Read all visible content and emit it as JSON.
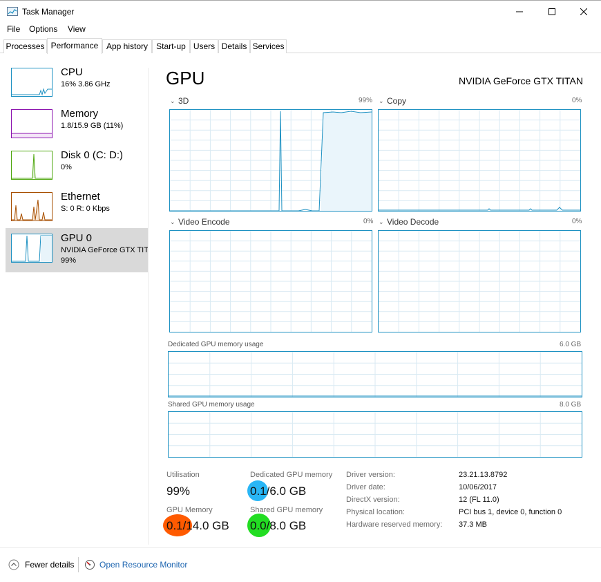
{
  "window": {
    "title": "Task Manager"
  },
  "menu": [
    "File",
    "Options",
    "View"
  ],
  "tabs": [
    "Processes",
    "Performance",
    "App history",
    "Start-up",
    "Users",
    "Details",
    "Services"
  ],
  "sidebar": [
    {
      "title": "CPU",
      "sub": "16% 3.86 GHz",
      "color": "#1d91c2"
    },
    {
      "title": "Memory",
      "sub": "1.8/15.9 GB (11%)",
      "color": "#8b12ae"
    },
    {
      "title": "Disk 0 (C: D:)",
      "sub": "0%",
      "color": "#4da60c"
    },
    {
      "title": "Ethernet",
      "sub": "S: 0 R: 0 Kbps",
      "color": "#a74f01"
    },
    {
      "title": "GPU 0",
      "sub": "NVIDIA GeForce GTX TITAN",
      "sub2": "99%",
      "color": "#1d91c2"
    }
  ],
  "gpu": {
    "heading": "GPU",
    "model": "NVIDIA GeForce GTX TITAN",
    "engines": [
      {
        "name": "3D",
        "max": "99%"
      },
      {
        "name": "Copy",
        "max": "0%"
      },
      {
        "name": "Video Encode",
        "max": "0%"
      },
      {
        "name": "Video Decode",
        "max": "0%"
      }
    ],
    "dedicated_usage": {
      "label": "Dedicated GPU memory usage",
      "max": "6.0 GB"
    },
    "shared_usage": {
      "label": "Shared GPU memory usage",
      "max": "8.0 GB"
    }
  },
  "stats": {
    "utilisation": {
      "label": "Utilisation",
      "value": "99%"
    },
    "dedicated": {
      "label": "Dedicated GPU memory",
      "value": "0.1/6.0 GB"
    },
    "gpu_memory": {
      "label": "GPU Memory",
      "value": "0.1/14.0 GB"
    },
    "shared": {
      "label": "Shared GPU memory",
      "value": "0.0/8.0 GB"
    }
  },
  "details": [
    {
      "key": "Driver version:",
      "value": "23.21.13.8792"
    },
    {
      "key": "Driver date:",
      "value": "10/06/2017"
    },
    {
      "key": "DirectX version:",
      "value": "12 (FL 11.0)"
    },
    {
      "key": "Physical location:",
      "value": "PCI bus 1, device 0, function 0"
    },
    {
      "key": "Hardware reserved memory:",
      "value": "37.3 MB"
    }
  ],
  "highlights": {
    "blue": "#29b6f6",
    "orange": "#ff5a00",
    "green": "#22dd22"
  },
  "footer": {
    "fewer": "Fewer details",
    "monitor": "Open Resource Monitor"
  }
}
